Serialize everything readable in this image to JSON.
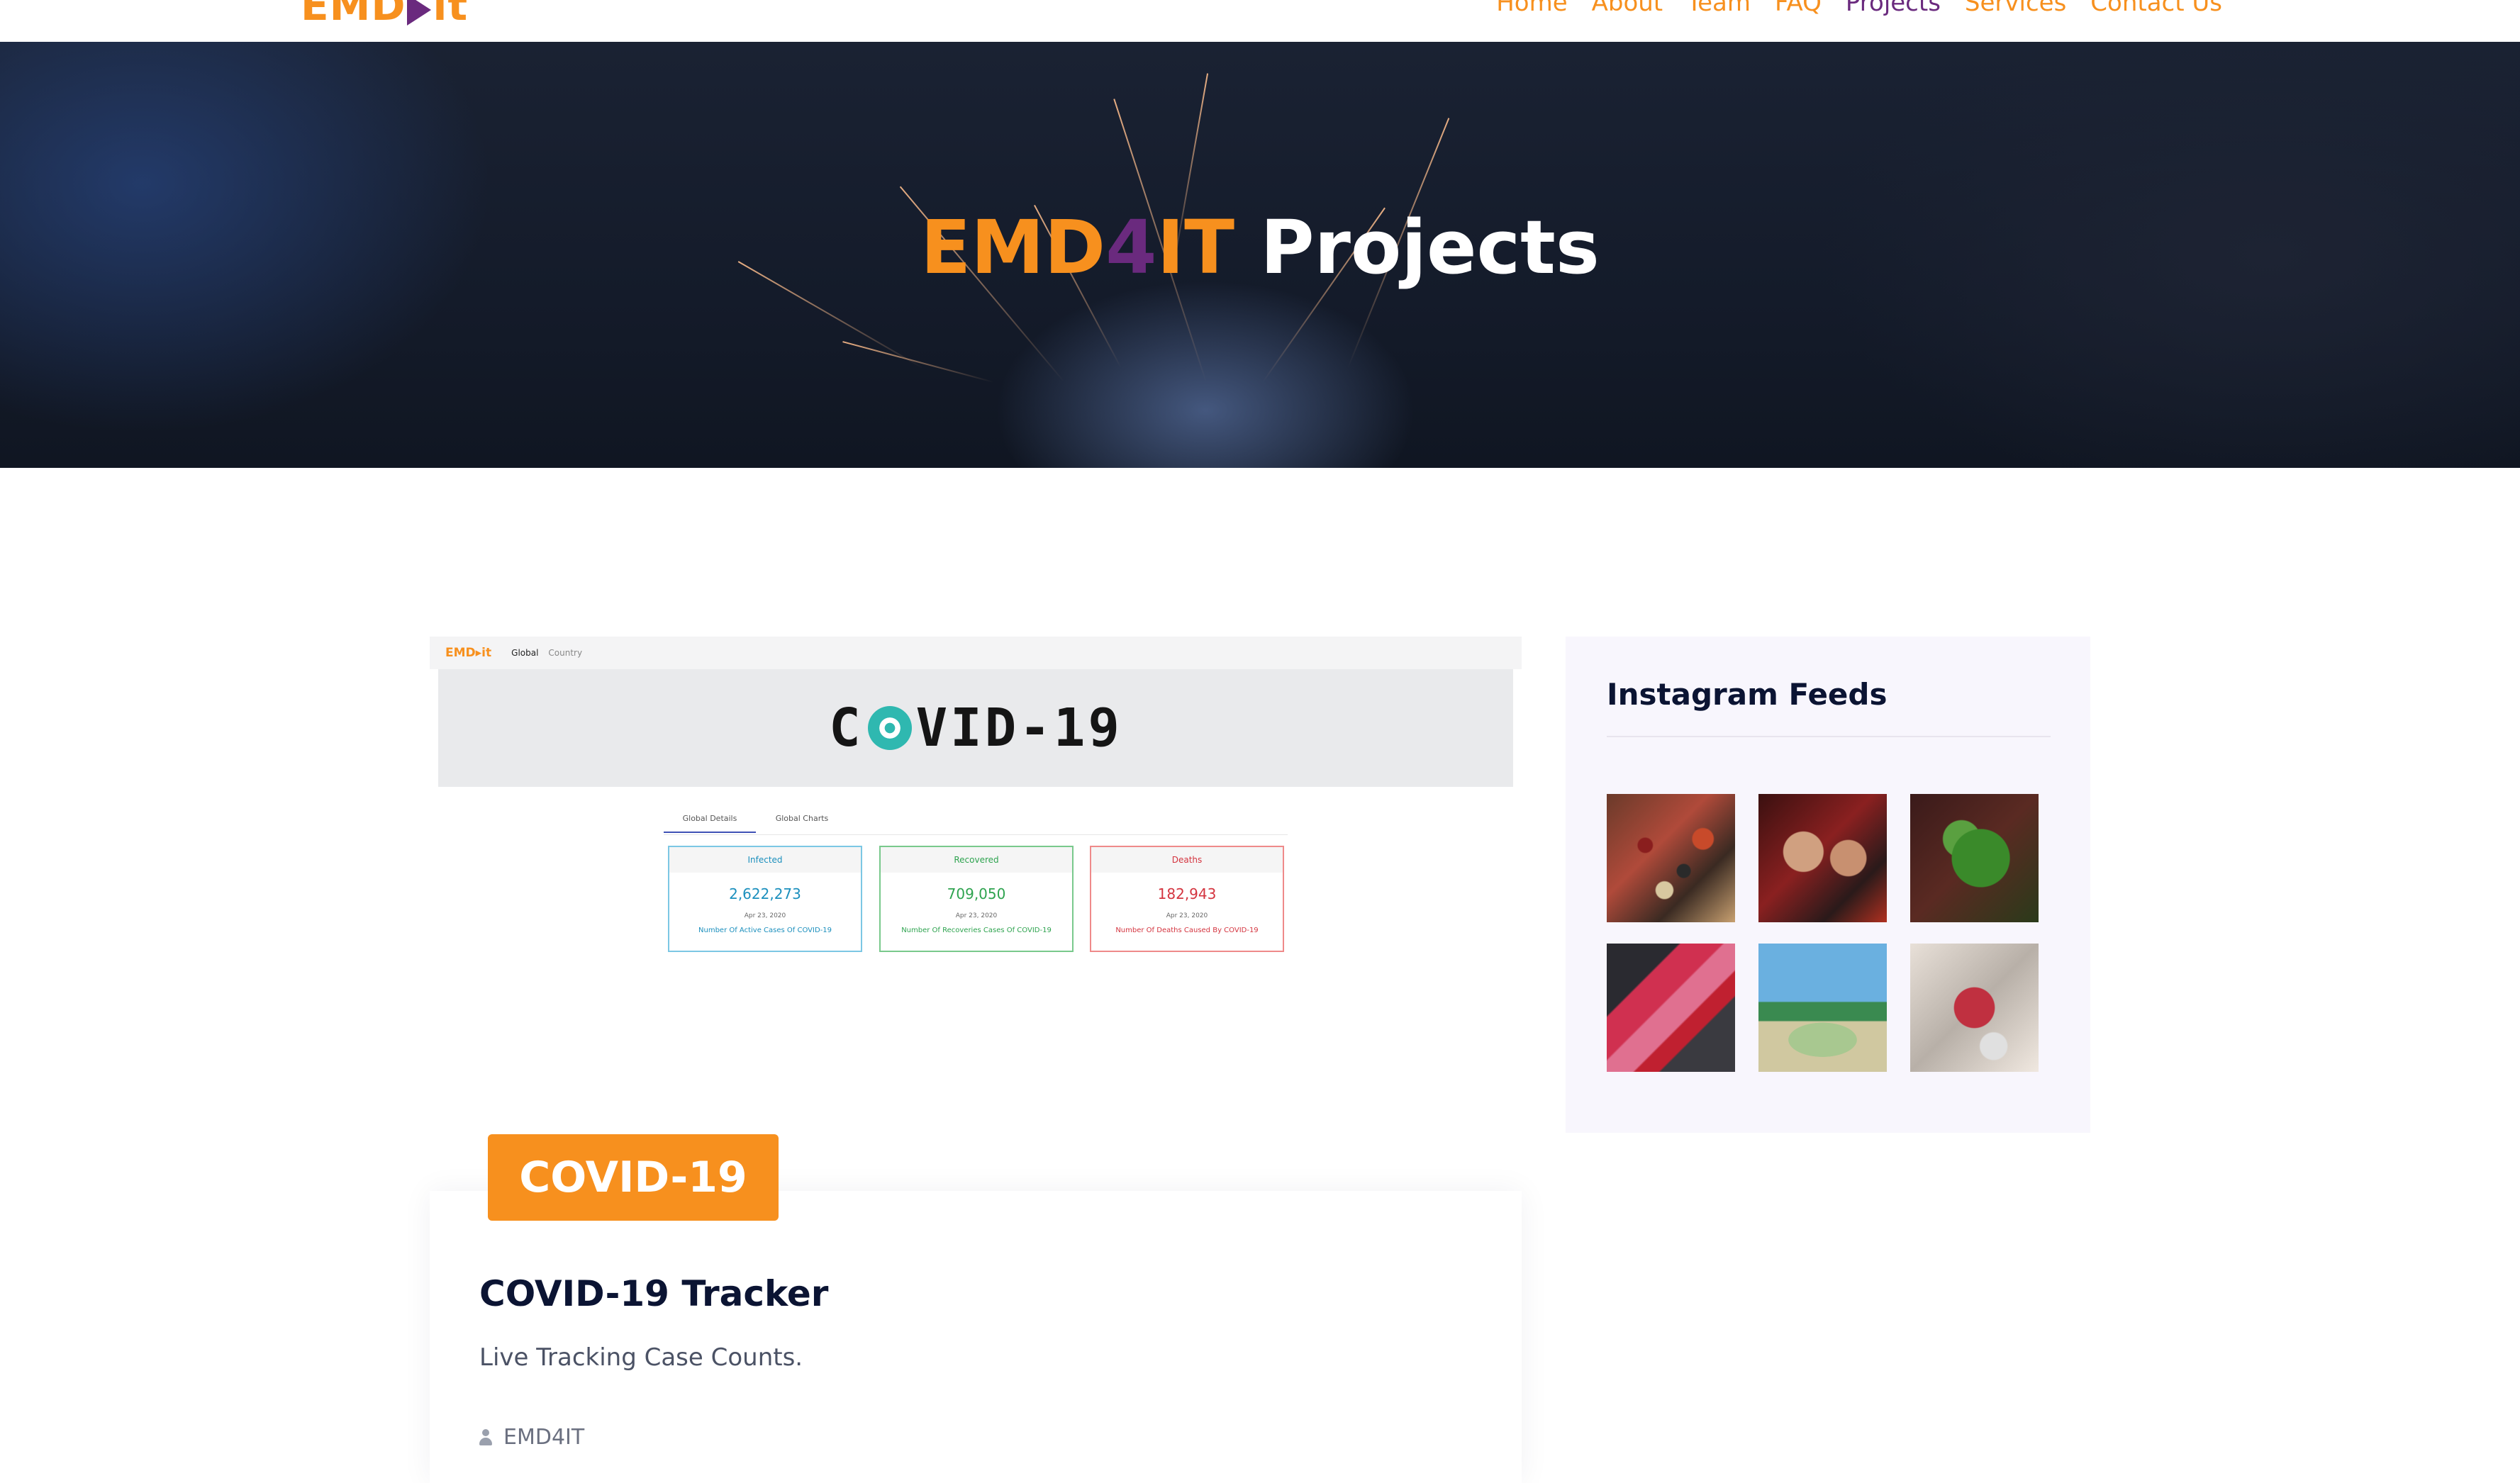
{
  "header": {
    "logo": {
      "text_pre": "EMD",
      "text_post": "it",
      "icon": "play-triangle-icon",
      "accent": "#f7901e",
      "accent2": "#6a2a7e"
    },
    "nav": [
      {
        "label": "Home",
        "active": false
      },
      {
        "label": "About",
        "active": false
      },
      {
        "label": "Team",
        "active": false
      },
      {
        "label": "FAQ",
        "active": false
      },
      {
        "label": "Projects",
        "active": true
      },
      {
        "label": "Services",
        "active": false
      },
      {
        "label": "Contact Us",
        "active": false
      }
    ]
  },
  "hero": {
    "title_org_a": "EMD",
    "title_org_b": "4",
    "title_org_c": "IT",
    "title_rest": "Projects"
  },
  "project": {
    "screenshot": {
      "nav_logo": "EMD▸it",
      "nav_links": [
        "Global",
        "Country"
      ],
      "banner_left": "C",
      "banner_right": "VID-19",
      "tabs": [
        "Global Details",
        "Global Charts"
      ],
      "stats": [
        {
          "label": "Infected",
          "value": "2,622,273",
          "date": "Apr 23, 2020",
          "desc": "Number Of Active Cases Of COVID-19",
          "color": "#1b8fbd"
        },
        {
          "label": "Recovered",
          "value": "709,050",
          "date": "Apr 23, 2020",
          "desc": "Number Of Recoveries Cases Of COVID-19",
          "color": "#2ea34f"
        },
        {
          "label": "Deaths",
          "value": "182,943",
          "date": "Apr 23, 2020",
          "desc": "Number Of Deaths Caused By COVID-19",
          "color": "#d4343f"
        }
      ]
    },
    "badge": "COVID-19",
    "title": "COVID-19 Tracker",
    "description": "Live Tracking Case Counts.",
    "author": "EMD4IT"
  },
  "sidebar": {
    "title": "Instagram Feeds",
    "images": [
      "peppercorns-photo",
      "friends-photo",
      "herbs-photo",
      "paint-brush-photo",
      "van-beach-photo",
      "drink-photo"
    ]
  }
}
